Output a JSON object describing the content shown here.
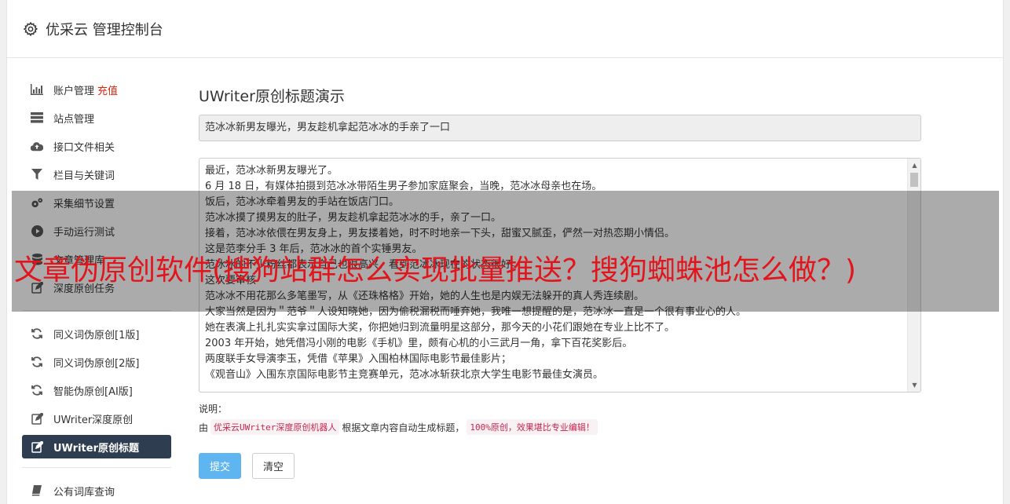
{
  "header": {
    "title": "优采云 管理控制台",
    "icon": "gear-icon"
  },
  "sidebar": {
    "items": [
      {
        "label": "账户管理",
        "extra": "充值",
        "icon": "bar-chart-icon"
      },
      {
        "label": "站点管理",
        "icon": "server-icon"
      },
      {
        "label": "接口文件相关",
        "icon": "cloud-upload-icon"
      },
      {
        "label": "栏目与关键词",
        "icon": "filter-icon"
      },
      {
        "label": "采集细节设置",
        "icon": "cogs-icon"
      },
      {
        "label": "手动运行测试",
        "icon": "play-circle-icon"
      },
      {
        "label": "文章管理库",
        "icon": "database-icon"
      },
      {
        "label": "深度原创任务",
        "icon": "edit-icon"
      },
      {
        "label": "同义词伪原创[1版]",
        "icon": "refresh-icon"
      },
      {
        "label": "同义词伪原创[2版]",
        "icon": "refresh-icon"
      },
      {
        "label": "智能伪原创[AI版]",
        "icon": "refresh-icon"
      },
      {
        "label": "UWriter深度原创",
        "icon": "edit-icon"
      },
      {
        "label": "UWriter原创标题",
        "icon": "edit-icon",
        "active": true
      },
      {
        "label": "公有词库查询",
        "icon": "book-icon"
      }
    ]
  },
  "main": {
    "page_title": "UWriter原创标题演示",
    "title_value": "范冰冰新男友曝光，男友趁机拿起范冰冰的手亲了一口",
    "content_lines": [
      "最近，范冰冰新男友曝光了。",
      "6 月 18 日，有媒体拍摄到范冰冰带陌生男子参加家庭聚会，当晚，范冰冰母亲也在场。",
      "饭后，范冰冰牵着男友的手站在饭店门口。",
      "范冰冰摸了摸男友的肚子，男友趁机拿起范冰冰的手，亲了一口。",
      "接着，范冰冰依偎在男友身上，男友搂着她，时不时地亲一下头，甜蜜又腻歪，俨然一对热恋期小情侣。",
      "这是范李分手 3 年后，范冰冰的首个实锤男友。",
      "范冰冰的不少粉丝都表示自己也很高兴，看到范冰冰现在的状态很好。",
      "这次要审核",
      "范冰冰不用花那么多笔墨写，从《还珠格格》开始，她的人生也是内娱无法躲开的真人秀连续剧。",
      "大家当然是因为＂范爷＂人设知晓她，因为偷税漏税而唾弃她，我唯一想提醒的是，范冰冰一直是一个很有事业心的人。",
      "她在表演上扎扎实实拿过国际大奖，你把她归到流量明星这部分，那今天的小花们跟她在专业上比不了。",
      "2003 年开始，她凭借冯小刚的电影《手机》里，颇有心机的小三武月一角，拿下百花奖影后。",
      "两度联手女导演李玉，凭借《苹果》入围柏林国际电影节最佳影片；",
      "《观音山》入围东京国际电影节主竞赛单元，范冰冰斩获北京大学生电影节最佳女演员。"
    ],
    "note_label": "说明：",
    "note_prefix": "由",
    "note_code1": "优采云UWriter深度原创机器人",
    "note_middle": "根据文章内容自动生成标题，",
    "note_code2": "100%原创，效果堪比专业编辑！",
    "submit_label": "提交",
    "clear_label": "清空"
  },
  "overlay": {
    "text": "文章伪原创软件(搜狗站群怎么实现批量推送？搜狗蜘蛛池怎么做？)"
  }
}
